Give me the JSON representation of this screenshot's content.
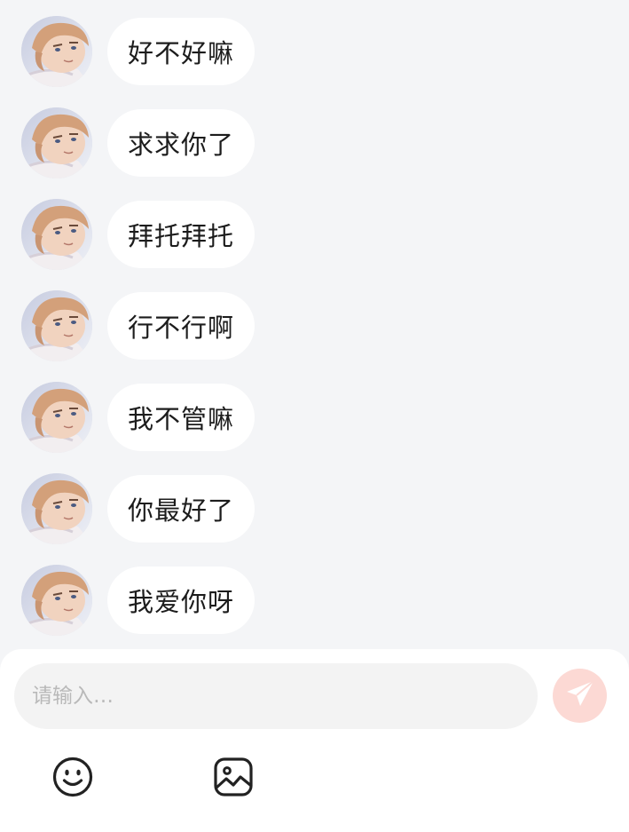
{
  "messages": [
    {
      "text": "好不好嘛"
    },
    {
      "text": "求求你了"
    },
    {
      "text": "拜托拜托"
    },
    {
      "text": "行不行啊"
    },
    {
      "text": "我不管嘛"
    },
    {
      "text": "你最好了"
    },
    {
      "text": "我爱你呀"
    }
  ],
  "composer": {
    "placeholder": "请输入…",
    "send_icon": "paper-plane-icon",
    "send_color": "#fcd9d4",
    "tools": [
      {
        "icon": "emoji-icon"
      },
      {
        "icon": "image-icon"
      }
    ]
  },
  "colors": {
    "background": "#f4f5f7",
    "bubble": "#ffffff",
    "text": "#1c1c1c"
  }
}
